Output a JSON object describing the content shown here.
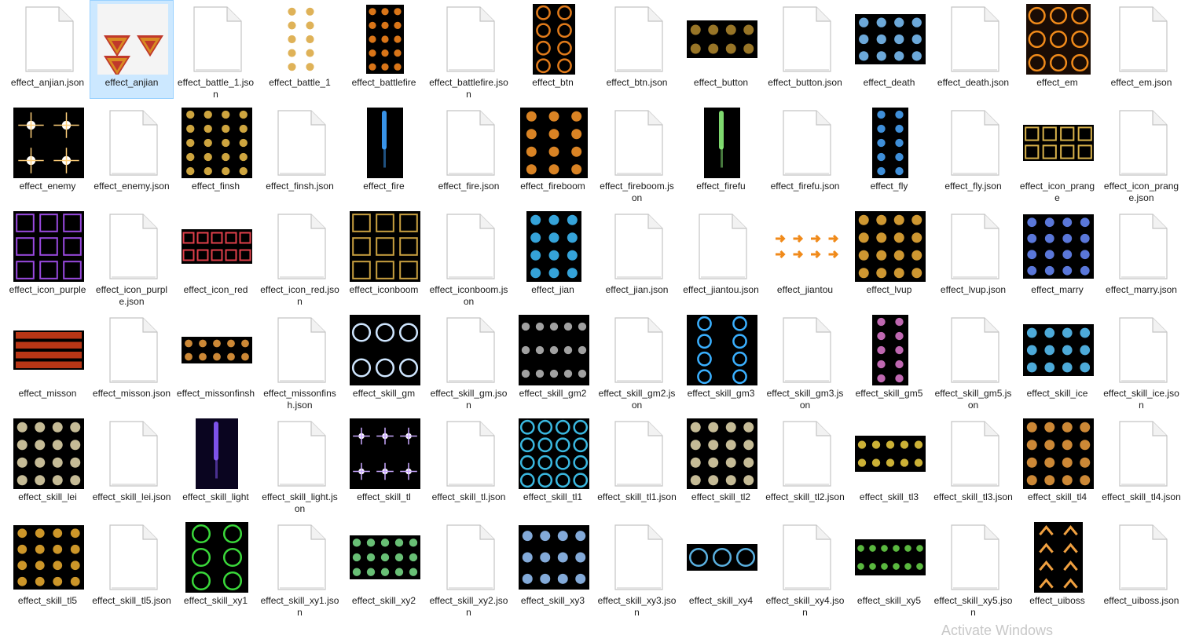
{
  "window": {
    "watermark": "Activate Windows"
  },
  "files": [
    {
      "name": "effect_anjian.json",
      "kind": "json"
    },
    {
      "name": "effect_anjian",
      "kind": "image",
      "w": 90,
      "h": 90,
      "bg": "#f4f4f4",
      "pattern": "triangles",
      "color": "#d98a22",
      "selected": true
    },
    {
      "name": "effect_battle_1.json",
      "kind": "json"
    },
    {
      "name": "effect_battle_1",
      "kind": "image",
      "w": 46,
      "h": 88,
      "bg": "#ffffff",
      "pattern": "grid",
      "cols": 2,
      "rows": 5,
      "color": "#d9a53b"
    },
    {
      "name": "effect_battlefire",
      "kind": "image",
      "w": 48,
      "h": 88,
      "bg": "#000000",
      "pattern": "grid",
      "cols": 3,
      "rows": 5,
      "color": "#ff8a1c"
    },
    {
      "name": "effect_battlefire.json",
      "kind": "json"
    },
    {
      "name": "effect_btn",
      "kind": "image",
      "w": 54,
      "h": 90,
      "bg": "#000000",
      "pattern": "rings",
      "cols": 2,
      "rows": 4,
      "color": "#e07a1a"
    },
    {
      "name": "effect_btn.json",
      "kind": "json"
    },
    {
      "name": "effect_button",
      "kind": "image",
      "w": 90,
      "h": 48,
      "bg": "#000000",
      "pattern": "grid",
      "cols": 4,
      "rows": 2,
      "color": "#b38a2e"
    },
    {
      "name": "effect_button.json",
      "kind": "json"
    },
    {
      "name": "effect_death",
      "kind": "image",
      "w": 90,
      "h": 64,
      "bg": "#000000",
      "pattern": "grid",
      "cols": 4,
      "rows": 3,
      "color": "#7fc6ff"
    },
    {
      "name": "effect_death.json",
      "kind": "json"
    },
    {
      "name": "effect_em",
      "kind": "image",
      "w": 82,
      "h": 90,
      "bg": "#1a0c05",
      "pattern": "rings",
      "cols": 3,
      "rows": 3,
      "color": "#f08a1a"
    },
    {
      "name": "effect_em.json",
      "kind": "json"
    },
    {
      "name": "effect_enemy",
      "kind": "image",
      "w": 90,
      "h": 90,
      "bg": "#000000",
      "pattern": "stars",
      "cols": 2,
      "rows": 2,
      "color": "#ffcf7a"
    },
    {
      "name": "effect_enemy.json",
      "kind": "json"
    },
    {
      "name": "effect_finsh",
      "kind": "image",
      "w": 90,
      "h": 90,
      "bg": "#000000",
      "pattern": "grid",
      "cols": 4,
      "rows": 5,
      "color": "#f2c24a"
    },
    {
      "name": "effect_finsh.json",
      "kind": "json"
    },
    {
      "name": "effect_fire",
      "kind": "image",
      "w": 46,
      "h": 90,
      "bg": "#000000",
      "pattern": "streak",
      "color": "#3ea2ff"
    },
    {
      "name": "effect_fire.json",
      "kind": "json"
    },
    {
      "name": "effect_fireboom",
      "kind": "image",
      "w": 86,
      "h": 90,
      "bg": "#000000",
      "pattern": "grid",
      "cols": 3,
      "rows": 4,
      "color": "#ff9a2a"
    },
    {
      "name": "effect_fireboom.json",
      "kind": "json"
    },
    {
      "name": "effect_firefu",
      "kind": "image",
      "w": 46,
      "h": 90,
      "bg": "#000000",
      "pattern": "streak",
      "color": "#8cf07a"
    },
    {
      "name": "effect_firefu.json",
      "kind": "json"
    },
    {
      "name": "effect_fly",
      "kind": "image",
      "w": 46,
      "h": 90,
      "bg": "#000000",
      "pattern": "grid",
      "cols": 2,
      "rows": 5,
      "color": "#4aa8ff"
    },
    {
      "name": "effect_fly.json",
      "kind": "json"
    },
    {
      "name": "effect_icon_prange",
      "kind": "image",
      "w": 90,
      "h": 46,
      "bg": "#000000",
      "pattern": "squares",
      "cols": 4,
      "rows": 2,
      "color": "#d9b24a"
    },
    {
      "name": "effect_icon_prange.json",
      "kind": "json"
    },
    {
      "name": "effect_icon_purple",
      "kind": "image",
      "w": 90,
      "h": 90,
      "bg": "#000000",
      "pattern": "squares",
      "cols": 3,
      "rows": 3,
      "color": "#9a4ae0"
    },
    {
      "name": "effect_icon_purple.json",
      "kind": "json"
    },
    {
      "name": "effect_icon_red",
      "kind": "image",
      "w": 90,
      "h": 44,
      "bg": "#000000",
      "pattern": "squares",
      "cols": 5,
      "rows": 2,
      "color": "#e0404a"
    },
    {
      "name": "effect_icon_red.json",
      "kind": "json"
    },
    {
      "name": "effect_iconboom",
      "kind": "image",
      "w": 90,
      "h": 90,
      "bg": "#000000",
      "pattern": "squares",
      "cols": 3,
      "rows": 3,
      "color": "#c9a040"
    },
    {
      "name": "effect_iconboom.json",
      "kind": "json"
    },
    {
      "name": "effect_jian",
      "kind": "image",
      "w": 70,
      "h": 90,
      "bg": "#000000",
      "pattern": "grid",
      "cols": 3,
      "rows": 4,
      "color": "#3ec0ff"
    },
    {
      "name": "effect_jian.json",
      "kind": "json"
    },
    {
      "name": "effect_jiantou.json",
      "kind": "json"
    },
    {
      "name": "effect_jiantou",
      "kind": "image",
      "w": 90,
      "h": 40,
      "bg": "#ffffff",
      "pattern": "arrows",
      "cols": 4,
      "rows": 2,
      "color": "#f08a1a"
    },
    {
      "name": "effect_lvup",
      "kind": "image",
      "w": 90,
      "h": 90,
      "bg": "#000000",
      "pattern": "grid",
      "cols": 4,
      "rows": 4,
      "color": "#f2b23a"
    },
    {
      "name": "effect_lvup.json",
      "kind": "json"
    },
    {
      "name": "effect_marry",
      "kind": "image",
      "w": 90,
      "h": 82,
      "bg": "#000000",
      "pattern": "grid",
      "cols": 4,
      "rows": 4,
      "color": "#6a8cff"
    },
    {
      "name": "effect_marry.json",
      "kind": "json"
    },
    {
      "name": "effect_misson",
      "kind": "image",
      "w": 90,
      "h": 50,
      "bg": "#000000",
      "pattern": "bars",
      "cols": 1,
      "rows": 4,
      "color": "#d8401a"
    },
    {
      "name": "effect_misson.json",
      "kind": "json"
    },
    {
      "name": "effect_missonfinsh",
      "kind": "image",
      "w": 90,
      "h": 34,
      "bg": "#000000",
      "pattern": "grid",
      "cols": 5,
      "rows": 2,
      "color": "#f0a040"
    },
    {
      "name": "effect_missonfinsh.json",
      "kind": "json"
    },
    {
      "name": "effect_skill_gm",
      "kind": "image",
      "w": 90,
      "h": 90,
      "bg": "#000000",
      "pattern": "rings",
      "cols": 3,
      "rows": 2,
      "color": "#cfe6ff"
    },
    {
      "name": "effect_skill_gm.json",
      "kind": "json"
    },
    {
      "name": "effect_skill_gm2",
      "kind": "image",
      "w": 90,
      "h": 90,
      "bg": "#000000",
      "pattern": "grid",
      "cols": 5,
      "rows": 3,
      "color": "#bdbdbd"
    },
    {
      "name": "effect_skill_gm2.json",
      "kind": "json"
    },
    {
      "name": "effect_skill_gm3",
      "kind": "image",
      "w": 90,
      "h": 90,
      "bg": "#000000",
      "pattern": "rings",
      "cols": 2,
      "rows": 4,
      "color": "#3ab0ff"
    },
    {
      "name": "effect_skill_gm3.json",
      "kind": "json"
    },
    {
      "name": "effect_skill_gm5",
      "kind": "image",
      "w": 46,
      "h": 90,
      "bg": "#000000",
      "pattern": "grid",
      "cols": 2,
      "rows": 5,
      "color": "#e07ad0"
    },
    {
      "name": "effect_skill_gm5.json",
      "kind": "json"
    },
    {
      "name": "effect_skill_ice",
      "kind": "image",
      "w": 90,
      "h": 66,
      "bg": "#000000",
      "pattern": "grid",
      "cols": 4,
      "rows": 3,
      "color": "#5ac8ff"
    },
    {
      "name": "effect_skill_ice.json",
      "kind": "json"
    },
    {
      "name": "effect_skill_lei",
      "kind": "image",
      "w": 90,
      "h": 90,
      "bg": "#000000",
      "pattern": "grid",
      "cols": 4,
      "rows": 4,
      "color": "#e8dcb0"
    },
    {
      "name": "effect_skill_lei.json",
      "kind": "json"
    },
    {
      "name": "effect_skill_light",
      "kind": "image",
      "w": 54,
      "h": 90,
      "bg": "#0a0520",
      "pattern": "streak",
      "color": "#8a5cff"
    },
    {
      "name": "effect_skill_light.json",
      "kind": "json"
    },
    {
      "name": "effect_skill_tl",
      "kind": "image",
      "w": 90,
      "h": 90,
      "bg": "#000000",
      "pattern": "stars",
      "cols": 3,
      "rows": 2,
      "color": "#c9a8ff"
    },
    {
      "name": "effect_skill_tl.json",
      "kind": "json"
    },
    {
      "name": "effect_skill_tl1",
      "kind": "image",
      "w": 90,
      "h": 90,
      "bg": "#000000",
      "pattern": "rings",
      "cols": 4,
      "rows": 4,
      "color": "#3ab8e0"
    },
    {
      "name": "effect_skill_tl1.json",
      "kind": "json"
    },
    {
      "name": "effect_skill_tl2",
      "kind": "image",
      "w": 90,
      "h": 90,
      "bg": "#000000",
      "pattern": "grid",
      "cols": 4,
      "rows": 4,
      "color": "#e8dcb0"
    },
    {
      "name": "effect_skill_tl2.json",
      "kind": "json"
    },
    {
      "name": "effect_skill_tl3",
      "kind": "image",
      "w": 90,
      "h": 46,
      "bg": "#000000",
      "pattern": "grid",
      "cols": 5,
      "rows": 2,
      "color": "#f0d040"
    },
    {
      "name": "effect_skill_tl3.json",
      "kind": "json"
    },
    {
      "name": "effect_skill_tl4",
      "kind": "image",
      "w": 90,
      "h": 90,
      "bg": "#000000",
      "pattern": "grid",
      "cols": 4,
      "rows": 4,
      "color": "#f0a040"
    },
    {
      "name": "effect_skill_tl4.json",
      "kind": "json"
    },
    {
      "name": "effect_skill_tl5",
      "kind": "image",
      "w": 90,
      "h": 82,
      "bg": "#000000",
      "pattern": "grid",
      "cols": 4,
      "rows": 4,
      "color": "#f0b030"
    },
    {
      "name": "effect_skill_tl5.json",
      "kind": "json"
    },
    {
      "name": "effect_skill_xy1",
      "kind": "image",
      "w": 80,
      "h": 90,
      "bg": "#000000",
      "pattern": "rings",
      "cols": 2,
      "rows": 3,
      "color": "#3ad83a"
    },
    {
      "name": "effect_skill_xy1.json",
      "kind": "json"
    },
    {
      "name": "effect_skill_xy2",
      "kind": "image",
      "w": 90,
      "h": 56,
      "bg": "#000000",
      "pattern": "grid",
      "cols": 5,
      "rows": 3,
      "color": "#7ae08a"
    },
    {
      "name": "effect_skill_xy2.json",
      "kind": "json"
    },
    {
      "name": "effect_skill_xy3",
      "kind": "image",
      "w": 90,
      "h": 82,
      "bg": "#000000",
      "pattern": "grid",
      "cols": 4,
      "rows": 3,
      "color": "#9ac8ff"
    },
    {
      "name": "effect_skill_xy3.json",
      "kind": "json"
    },
    {
      "name": "effect_skill_xy4",
      "kind": "image",
      "w": 90,
      "h": 34,
      "bg": "#000000",
      "pattern": "rings",
      "cols": 3,
      "rows": 1,
      "color": "#5ab0e0"
    },
    {
      "name": "effect_skill_xy4.json",
      "kind": "json"
    },
    {
      "name": "effect_skill_xy5",
      "kind": "image",
      "w": 90,
      "h": 46,
      "bg": "#000000",
      "pattern": "grid",
      "cols": 6,
      "rows": 2,
      "color": "#6ad84a"
    },
    {
      "name": "effect_skill_xy5.json",
      "kind": "json"
    },
    {
      "name": "effect_uiboss",
      "kind": "image",
      "w": 62,
      "h": 90,
      "bg": "#000000",
      "pattern": "chevrons",
      "cols": 2,
      "rows": 4,
      "color": "#f0a040"
    },
    {
      "name": "effect_uiboss.json",
      "kind": "json"
    }
  ]
}
